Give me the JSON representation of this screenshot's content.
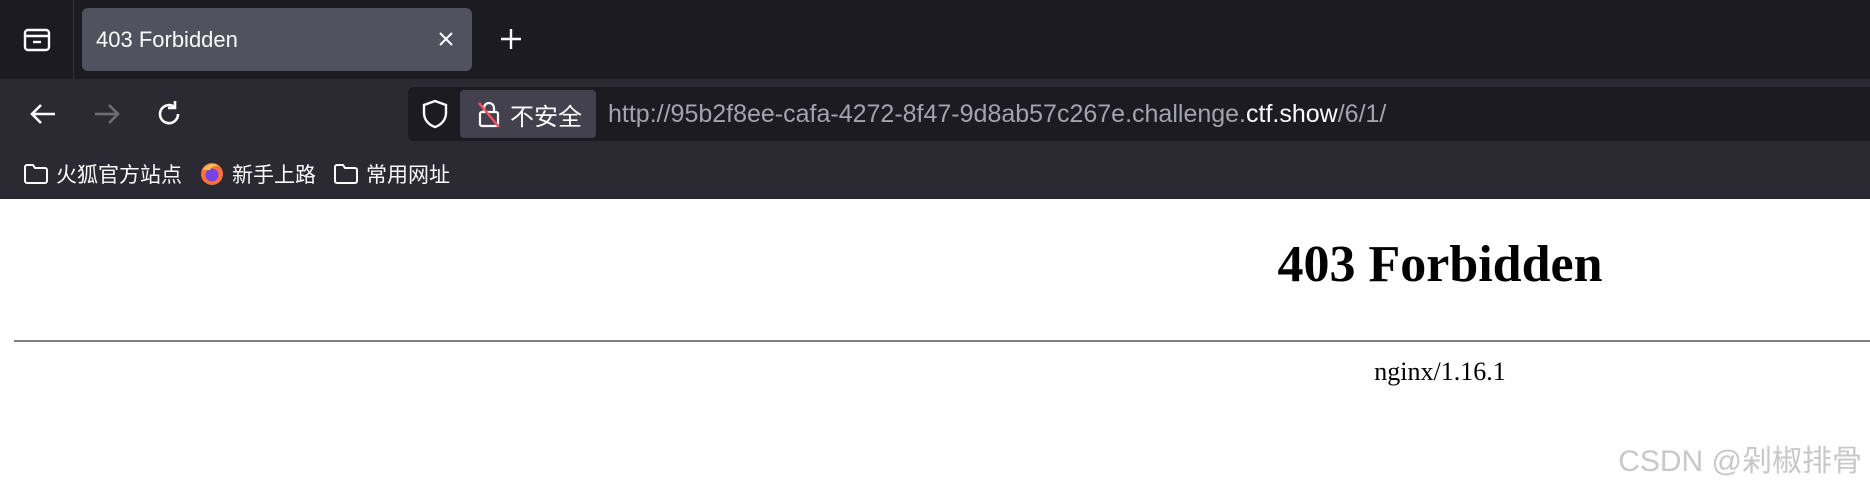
{
  "browser": {
    "tab": {
      "title": "403 Forbidden"
    },
    "urlbar": {
      "insecure_label": "不安全",
      "url_prefix": "http://95b2f8ee-cafa-4272-8f47-9d8ab57c267e.challenge.",
      "url_host": "ctf.show",
      "url_path": "/6/1/"
    },
    "bookmarks": [
      {
        "label": "火狐官方站点",
        "icon": "folder-icon"
      },
      {
        "label": "新手上路",
        "icon": "firefox-logo"
      },
      {
        "label": "常用网址",
        "icon": "folder-icon"
      }
    ],
    "colors": {
      "tabstrip_bg": "#1c1b22",
      "toolbar_bg": "#2b2a33",
      "active_tab_bg": "#52525e"
    }
  },
  "page": {
    "heading": "403 Forbidden",
    "server_signature": "nginx/1.16.1"
  },
  "watermark": "CSDN @剁椒排骨"
}
